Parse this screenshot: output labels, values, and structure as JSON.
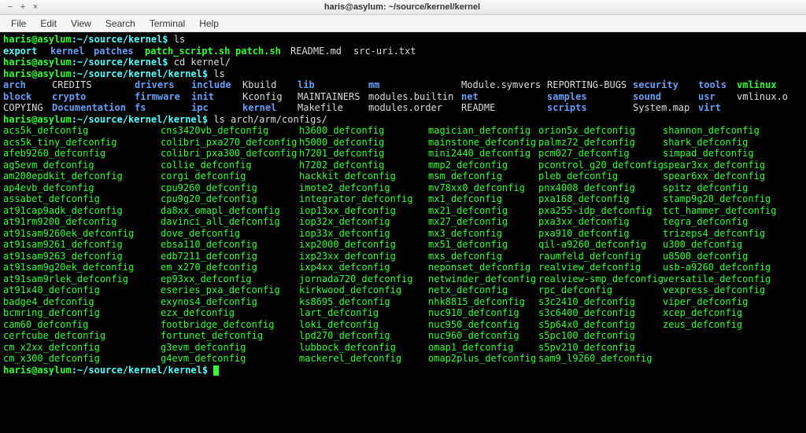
{
  "titlebar": {
    "title": "haris@asylum: ~/source/kernel/kernel",
    "minus": "−",
    "plus": "+",
    "close": "×"
  },
  "menu": {
    "file": "File",
    "edit": "Edit",
    "view": "View",
    "search": "Search",
    "terminal": "Terminal",
    "help": "Help"
  },
  "p1": {
    "user": "haris@asylum",
    "path": ":~/source/kernel$ ",
    "cmd": "ls"
  },
  "ls1": [
    "export",
    "kernel",
    "patches",
    "patch_script.sh",
    "patch.sh",
    "README.md",
    "src-uri.txt"
  ],
  "p2": {
    "user": "haris@asylum",
    "path": ":~/source/kernel$ ",
    "cmd": "cd kernel/"
  },
  "p3": {
    "user": "haris@asylum",
    "path": ":~/source/kernel/kernel$ ",
    "cmd": "ls"
  },
  "kdir": [
    [
      "arch",
      "CREDITS",
      "drivers",
      "include",
      "Kbuild",
      "lib",
      "mm",
      "Module.symvers",
      "REPORTING-BUGS",
      "security",
      "tools",
      "vmlinux"
    ],
    [
      "block",
      "crypto",
      "firmware",
      "init",
      "Kconfig",
      "MAINTAINERS",
      "modules.builtin",
      "net",
      "samples",
      "sound",
      "usr",
      "vmlinux.o"
    ],
    [
      "COPYING",
      "Documentation",
      "fs",
      "ipc",
      "kernel",
      "Makefile",
      "modules.order",
      "README",
      "scripts",
      "System.map",
      "virt",
      ""
    ]
  ],
  "kdir_colors": [
    [
      "blue",
      "white",
      "blue",
      "blue",
      "white",
      "blue",
      "blue",
      "white",
      "white",
      "blue",
      "blue",
      "green"
    ],
    [
      "blue",
      "blue",
      "blue",
      "blue",
      "white",
      "white",
      "white",
      "blue",
      "blue",
      "blue",
      "blue",
      "white"
    ],
    [
      "white",
      "blue",
      "blue",
      "blue",
      "blue",
      "white",
      "white",
      "white",
      "blue",
      "white",
      "blue",
      "white"
    ]
  ],
  "p4": {
    "user": "haris@asylum",
    "path": ":~/source/kernel/kernel$ ",
    "cmd": "ls arch/arm/configs/"
  },
  "configs": [
    [
      "acs5k_defconfig",
      "cns3420vb_defconfig",
      "h3600_defconfig",
      "magician_defconfig",
      "orion5x_defconfig",
      "shannon_defconfig"
    ],
    [
      "acs5k_tiny_defconfig",
      "colibri_pxa270_defconfig",
      "h5000_defconfig",
      "mainstone_defconfig",
      "palmz72_defconfig",
      "shark_defconfig"
    ],
    [
      "afeb9260_defconfig",
      "colibri_pxa300_defconfig",
      "h7201_defconfig",
      "mini2440_defconfig",
      "pcm027_defconfig",
      "simpad_defconfig"
    ],
    [
      "ag5evm_defconfig",
      "collie_defconfig",
      "h7202_defconfig",
      "mmp2_defconfig",
      "pcontrol_g20_defconfig",
      "spear3xx_defconfig"
    ],
    [
      "am200epdkit_defconfig",
      "corgi_defconfig",
      "hackkit_defconfig",
      "msm_defconfig",
      "pleb_defconfig",
      "spear6xx_defconfig"
    ],
    [
      "ap4evb_defconfig",
      "cpu9260_defconfig",
      "imote2_defconfig",
      "mv78xx0_defconfig",
      "pnx4008_defconfig",
      "spitz_defconfig"
    ],
    [
      "assabet_defconfig",
      "cpu9g20_defconfig",
      "integrator_defconfig",
      "mx1_defconfig",
      "pxa168_defconfig",
      "stamp9g20_defconfig"
    ],
    [
      "at91cap9adk_defconfig",
      "da8xx_omapl_defconfig",
      "iop13xx_defconfig",
      "mx21_defconfig",
      "pxa255-idp_defconfig",
      "tct_hammer_defconfig"
    ],
    [
      "at91rm9200_defconfig",
      "davinci_all_defconfig",
      "iop32x_defconfig",
      "mx27_defconfig",
      "pxa3xx_defconfig",
      "tegra_defconfig"
    ],
    [
      "at91sam9260ek_defconfig",
      "dove_defconfig",
      "iop33x_defconfig",
      "mx3_defconfig",
      "pxa910_defconfig",
      "trizeps4_defconfig"
    ],
    [
      "at91sam9261_defconfig",
      "ebsa110_defconfig",
      "ixp2000_defconfig",
      "mx51_defconfig",
      "qil-a9260_defconfig",
      "u300_defconfig"
    ],
    [
      "at91sam9263_defconfig",
      "edb7211_defconfig",
      "ixp23xx_defconfig",
      "mxs_defconfig",
      "raumfeld_defconfig",
      "u8500_defconfig"
    ],
    [
      "at91sam9g20ek_defconfig",
      "em_x270_defconfig",
      "ixp4xx_defconfig",
      "neponset_defconfig",
      "realview_defconfig",
      "usb-a9260_defconfig"
    ],
    [
      "at91sam9rlek_defconfig",
      "ep93xx_defconfig",
      "jornada720_defconfig",
      "netwinder_defconfig",
      "realview-smp_defconfig",
      "versatile_defconfig"
    ],
    [
      "at91x40_defconfig",
      "eseries_pxa_defconfig",
      "kirkwood_defconfig",
      "netx_defconfig",
      "rpc_defconfig",
      "vexpress_defconfig"
    ],
    [
      "badge4_defconfig",
      "exynos4_defconfig",
      "ks8695_defconfig",
      "nhk8815_defconfig",
      "s3c2410_defconfig",
      "viper_defconfig"
    ],
    [
      "bcmring_defconfig",
      "ezx_defconfig",
      "lart_defconfig",
      "nuc910_defconfig",
      "s3c6400_defconfig",
      "xcep_defconfig"
    ],
    [
      "cam60_defconfig",
      "footbridge_defconfig",
      "loki_defconfig",
      "nuc950_defconfig",
      "s5p64x0_defconfig",
      "zeus_defconfig"
    ],
    [
      "cerfcube_defconfig",
      "fortunet_defconfig",
      "lpd270_defconfig",
      "nuc960_defconfig",
      "s5pc100_defconfig",
      ""
    ],
    [
      "cm_x2xx_defconfig",
      "g3evm_defconfig",
      "lubbock_defconfig",
      "omap1_defconfig",
      "s5pv210_defconfig",
      ""
    ],
    [
      "cm_x300_defconfig",
      "g4evm_defconfig",
      "mackerel_defconfig",
      "omap2plus_defconfig",
      "sam9_l9260_defconfig",
      ""
    ]
  ],
  "p5": {
    "user": "haris@asylum",
    "path": ":~/source/kernel/kernel$ "
  }
}
